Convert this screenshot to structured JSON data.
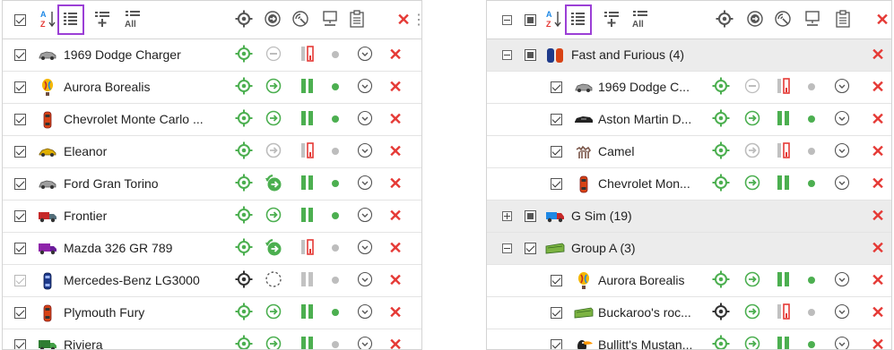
{
  "colors": {
    "accent_purple": "#9b3fd6",
    "green": "#4caf50",
    "red": "#e53935",
    "gray": "#b5b5b5",
    "blue": "#1e88e5"
  },
  "toolbar_icons": [
    "select-all-checkbox",
    "sort-az-icon",
    "list-icon",
    "group-add-icon",
    "all-icon",
    "locate-icon",
    "follow-icon",
    "tracking-icon",
    "computer-icon",
    "clipboard-icon",
    "close-icon",
    "more-icon"
  ],
  "toolbar_labels": {
    "sort": "Az",
    "all": "All",
    "close": "✕",
    "more": "⋮"
  },
  "left": {
    "units": [
      {
        "name": "1969 Dodge Charger",
        "icon": "car-gray-icon",
        "checked": true,
        "locate": "green",
        "follow": "disabled",
        "signal": "red",
        "dot": "gray",
        "x": true
      },
      {
        "name": "Aurora Borealis",
        "icon": "balloon-icon",
        "checked": true,
        "locate": "green",
        "follow": "green",
        "signal": "green",
        "dot": "green",
        "x": true
      },
      {
        "name": "Chevrolet Monte Carlo ...",
        "icon": "red-car-icon",
        "checked": true,
        "locate": "green",
        "follow": "green",
        "signal": "green",
        "dot": "green",
        "x": true
      },
      {
        "name": "Eleanor",
        "icon": "yellow-car-icon",
        "checked": true,
        "locate": "green",
        "follow": "gray",
        "signal": "red",
        "dot": "gray",
        "x": true
      },
      {
        "name": "Ford Gran Torino",
        "icon": "car-gray-icon",
        "checked": true,
        "locate": "green",
        "follow": "green-track",
        "signal": "green",
        "dot": "green",
        "x": true
      },
      {
        "name": "Frontier",
        "icon": "truck-red-icon",
        "checked": true,
        "locate": "green",
        "follow": "green",
        "signal": "green",
        "dot": "green",
        "x": true
      },
      {
        "name": "Mazda 326 GR 789",
        "icon": "purple-truck-icon",
        "checked": true,
        "locate": "green",
        "follow": "green-track",
        "signal": "red",
        "dot": "gray",
        "x": true
      },
      {
        "name": "Mercedes-Benz LG3000",
        "icon": "blue-car-icon",
        "checked": false,
        "locate": "black",
        "follow": "dashed",
        "signal": "gray",
        "dot": "gray",
        "x": true
      },
      {
        "name": "Plymouth Fury",
        "icon": "red-car-icon",
        "checked": true,
        "locate": "green",
        "follow": "green",
        "signal": "green",
        "dot": "green",
        "x": true
      },
      {
        "name": "Riviera",
        "icon": "green-truck-icon",
        "checked": true,
        "locate": "green",
        "follow": "green",
        "signal": "green",
        "dot": "gray",
        "x": true
      }
    ]
  },
  "right": {
    "rows": [
      {
        "type": "group",
        "name": "Fast and Furious (4)",
        "expanded": true,
        "icon": "group-cars-icon"
      },
      {
        "type": "unit",
        "name": "1969 Dodge C...",
        "icon": "car-gray-icon",
        "locate": "green",
        "follow": "disabled",
        "signal": "red",
        "dot": "gray"
      },
      {
        "type": "unit",
        "name": "Aston Martin D...",
        "icon": "black-car-icon",
        "locate": "green",
        "follow": "green",
        "signal": "green",
        "dot": "green"
      },
      {
        "type": "unit",
        "name": "Camel",
        "icon": "camel-icon",
        "locate": "green",
        "follow": "gray",
        "signal": "red",
        "dot": "gray"
      },
      {
        "type": "unit",
        "name": "Chevrolet Mon...",
        "icon": "red-car-icon",
        "locate": "green",
        "follow": "green",
        "signal": "green",
        "dot": "green"
      },
      {
        "type": "group",
        "name": "G Sim (19)",
        "expanded": false,
        "icon": "blue-truck-icon"
      },
      {
        "type": "group",
        "name": "Group A (3)",
        "expanded": true,
        "icon": "green-bus-icon"
      },
      {
        "type": "unit",
        "name": "Aurora Borealis",
        "icon": "balloon-icon",
        "locate": "green",
        "follow": "green",
        "signal": "green",
        "dot": "green"
      },
      {
        "type": "unit",
        "name": "Buckaroo's roc...",
        "icon": "green-bus-icon",
        "locate": "black",
        "follow": "green",
        "signal": "red",
        "dot": "gray"
      },
      {
        "type": "unit",
        "name": "Bullitt's Mustan...",
        "icon": "toucan-icon",
        "locate": "green",
        "follow": "green",
        "signal": "green",
        "dot": "green"
      }
    ]
  }
}
